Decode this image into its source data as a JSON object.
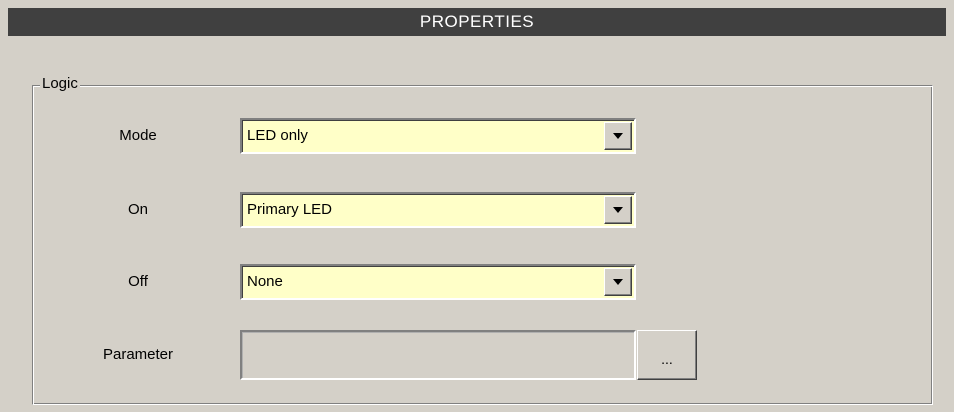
{
  "window": {
    "title": "PROPERTIES"
  },
  "group": {
    "legend": "Logic"
  },
  "fields": [
    {
      "label": "Mode",
      "value": "LED only"
    },
    {
      "label": "On",
      "value": "Primary LED"
    },
    {
      "label": "Off",
      "value": "None"
    }
  ],
  "parameter": {
    "label": "Parameter",
    "value": "",
    "browse_label": "..."
  },
  "colors": {
    "panel_bg": "#d4d0c8",
    "title_bg": "#404040",
    "combo_bg": "#ffffc8"
  },
  "icons": {
    "dropdown": "chevron-down-icon"
  }
}
